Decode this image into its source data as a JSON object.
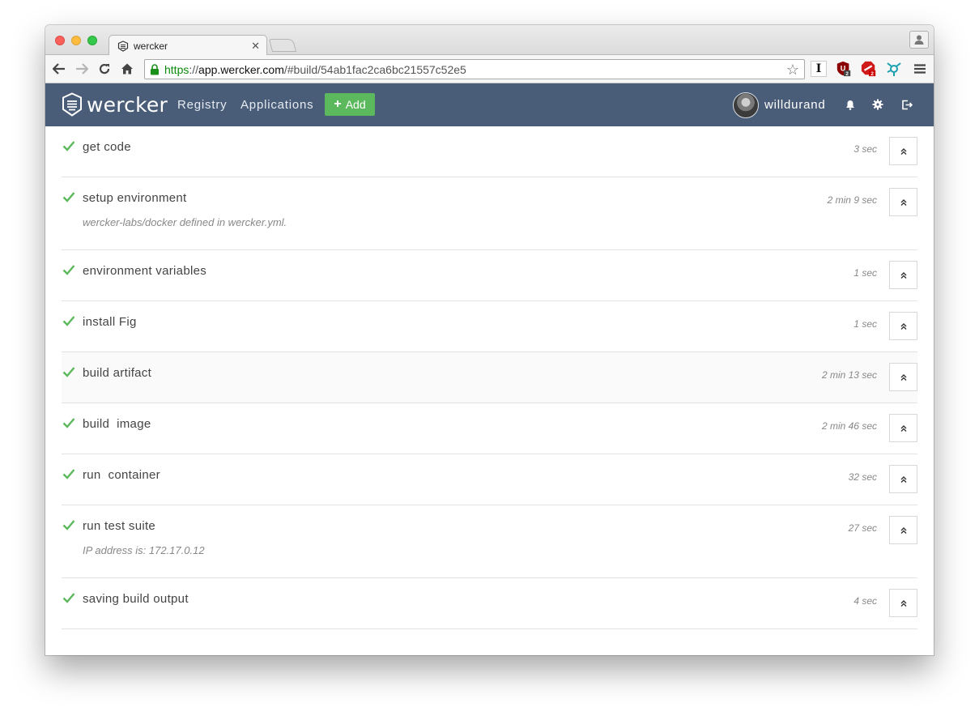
{
  "browser": {
    "tab_title": "wercker",
    "url_scheme": "https",
    "url_scheme_sep": "://",
    "url_host": "app.wercker.com",
    "url_path": "/#build/54ab1fac2ca6bc21557c52e5",
    "extensions": [
      {
        "name": "instapaper-icon",
        "label": "I"
      },
      {
        "name": "ublock-icon",
        "label": "U",
        "badge": "2"
      },
      {
        "name": "adblock-icon",
        "badge": "2"
      },
      {
        "name": "network-icon"
      }
    ]
  },
  "header": {
    "logo_text": "wercker",
    "nav": [
      "Registry",
      "Applications"
    ],
    "add_label": "Add",
    "username": "willdurand",
    "brand_color": "#4a5d78",
    "accent_color": "#5cb85c"
  },
  "steps": [
    {
      "name": "get code",
      "duration": "3 sec",
      "status": "passed"
    },
    {
      "name": "setup environment",
      "duration": "2 min 9 sec",
      "message": "wercker-labs/docker defined in wercker.yml.",
      "status": "passed"
    },
    {
      "name": "environment variables",
      "duration": "1 sec",
      "status": "passed"
    },
    {
      "name": "install Fig",
      "duration": "1 sec",
      "status": "passed"
    },
    {
      "name": "build artifact",
      "duration": "2 min 13 sec",
      "status": "passed"
    },
    {
      "name": "build  image",
      "duration": "2 min 46 sec",
      "status": "passed"
    },
    {
      "name": "run  container",
      "duration": "32 sec",
      "status": "passed"
    },
    {
      "name": "run test suite",
      "duration": "27 sec",
      "message": "IP address is: 172.17.0.12",
      "status": "passed"
    },
    {
      "name": "saving build output",
      "duration": "4 sec",
      "status": "passed"
    }
  ]
}
